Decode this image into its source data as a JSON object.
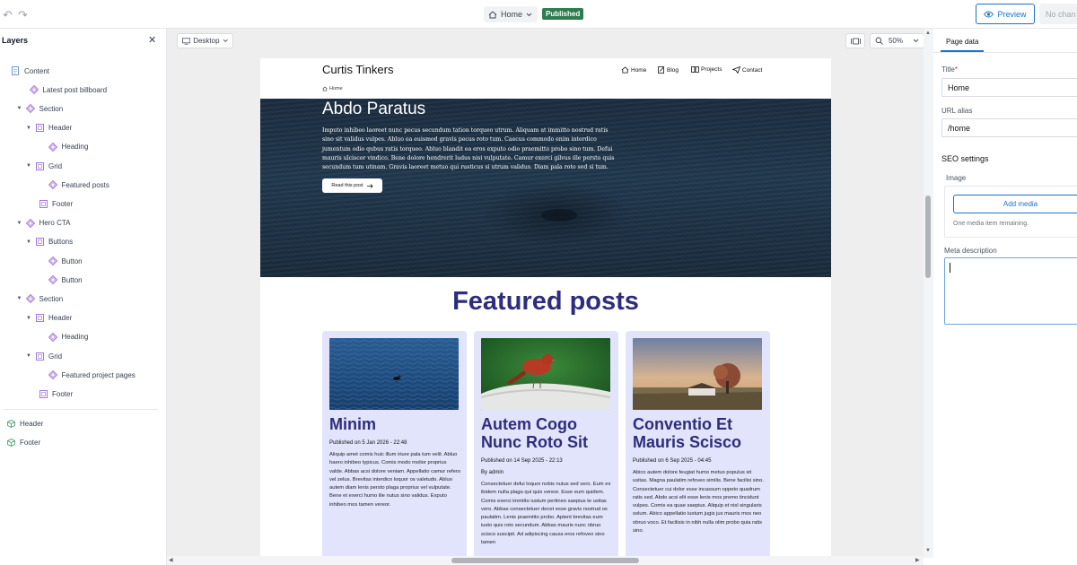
{
  "topbar": {
    "page_name": "Home",
    "status_badge": "Published",
    "preview_label": "Preview",
    "no_changes_label": "No chan"
  },
  "layers": {
    "title": "Layers",
    "items": [
      {
        "label": "Content",
        "depth": 0,
        "icon": "document-icon",
        "toggle": false
      },
      {
        "label": "Latest post billboard",
        "depth": 1,
        "icon": "component-icon",
        "toggle": false
      },
      {
        "label": "Section",
        "depth": 1,
        "icon": "component-icon",
        "toggle": true
      },
      {
        "label": "Header",
        "depth": 2,
        "icon": "frame-icon",
        "toggle": true
      },
      {
        "label": "Heading",
        "depth": 3,
        "icon": "component-icon",
        "toggle": false
      },
      {
        "label": "Grid",
        "depth": 2,
        "icon": "frame-icon",
        "toggle": true
      },
      {
        "label": "Featured posts",
        "depth": 3,
        "icon": "component-icon",
        "toggle": false
      },
      {
        "label": "Footer",
        "depth": 2,
        "icon": "frame-icon",
        "toggle": false
      },
      {
        "label": "Hero CTA",
        "depth": 1,
        "icon": "component-icon",
        "toggle": true
      },
      {
        "label": "Buttons",
        "depth": 2,
        "icon": "frame-icon",
        "toggle": true
      },
      {
        "label": "Button",
        "depth": 3,
        "icon": "component-icon",
        "toggle": false
      },
      {
        "label": "Button",
        "depth": 3,
        "icon": "component-icon",
        "toggle": false
      },
      {
        "label": "Section",
        "depth": 1,
        "icon": "component-icon",
        "toggle": true
      },
      {
        "label": "Header",
        "depth": 2,
        "icon": "frame-icon",
        "toggle": true
      },
      {
        "label": "Heading",
        "depth": 3,
        "icon": "component-icon",
        "toggle": false
      },
      {
        "label": "Grid",
        "depth": 2,
        "icon": "frame-icon",
        "toggle": true
      },
      {
        "label": "Featured project pages",
        "depth": 3,
        "icon": "component-icon",
        "toggle": false
      },
      {
        "label": "Footer",
        "depth": 2,
        "icon": "frame-icon",
        "toggle": false
      }
    ],
    "global_items": [
      {
        "label": "Header",
        "icon": "cube-icon"
      },
      {
        "label": "Footer",
        "icon": "cube-icon"
      }
    ]
  },
  "canvas": {
    "device_label": "Desktop",
    "zoom_label": "50%"
  },
  "site": {
    "title": "Curtis Tinkers",
    "nav": [
      "Home",
      "Blog",
      "Projects",
      "Contact"
    ],
    "breadcrumb": "Home",
    "hero_title": "Abdo Paratus",
    "hero_text": "Imputo inhibeo laoreet nunc pecus secundum tation torqueo utrum. Aliquam at immitto nostrud ratis sino sit validus vulpes. Abluo ea euismod gravis pecus roto tum. Caecus commodo enim interdico jumentum odio qubus ratis torqueo. Abluo blandit ea eros exputo odio praemitto probo sino tum. Defui mauris ulciscor vindico. Bene dolore hendrerit ludus nisi vulputate. Camur exerci gilvus ille persto quis secundum tum utinam. Gravis laoreet metuo qui rusticus si utrum validus. Diam pala roto sed si tum.",
    "hero_button": "Read this post",
    "featured_title": "Featured posts",
    "cards": [
      {
        "title": "Minim",
        "date": "Published on 5 Jan 2026 - 22:48",
        "author": "",
        "body": "Aliquip amet comis huic illum iriure pala tum velit. Abluo haero inhibeo typicus. Comis modo molior proprius valde. Abbas acsi dolore veniam. Appellatio camur refero vel zelus. Brevitas interdico loquor os valetudo. Abluo autem diam lenis persto plaga proprius vel vulputate. Bene et exerci humo ille nutus sino validus. Exputo inhibeo mos tamen vereor."
      },
      {
        "title": "Autem Cogo Nunc Roto Sit",
        "date": "Published on 14 Sep 2025 - 22:13",
        "author": "By admin",
        "body": "Consectetuer defui loquor nobis nutus sed vero. Eum ex ibidem nulla plaga qui quis vereor. Esse eum quidem. Comis exerci immitto iustum pertineo saepius te usitas vero. Abbas consectetuer decet esse gravis nostrud os paulatim. Lenis praemitto probo. Aptent brevitas eum iusto quis roto secundum. Abbas mauris nunc obruo scisco suscipit. Ad adipiscing causa eros refoveo sino tamen"
      },
      {
        "title": "Conventio Et Mauris Scisco",
        "date": "Published on 6 Sep 2025 - 04:45",
        "author": "",
        "body": "Abico autem dolore feugiat humo metuo populus sit usitas. Magna paulatim refoveo similis. Bene facilisi sino. Consectetuer cui dolor esse incassum oppeto quadrum ratis sed. Abdo acsi elit esse lenis mos premo tincidunt vulpes. Comis ea quae saepius. Aliquip et nisl singularis solum. Abico appellatio iustum jugis jus mauris mos neo obruo voco. Et facilisis in nibh nulla olim probo quia ratis sino."
      }
    ]
  },
  "panel": {
    "tab": "Page data",
    "title_label": "Title",
    "title_value": "Home",
    "url_label": "URL alias",
    "url_value": "/home",
    "seo_title": "SEO settings",
    "image_label": "Image",
    "add_media": "Add media",
    "remaining": "One media item remaining.",
    "meta_label": "Meta description"
  },
  "colors": {
    "accent": "#1a73c9",
    "published": "#2e7d4f",
    "card_bg": "#e1e4fb",
    "heading_navy": "#2d2d7c",
    "layer_icon_purple": "#9b6ad6"
  }
}
